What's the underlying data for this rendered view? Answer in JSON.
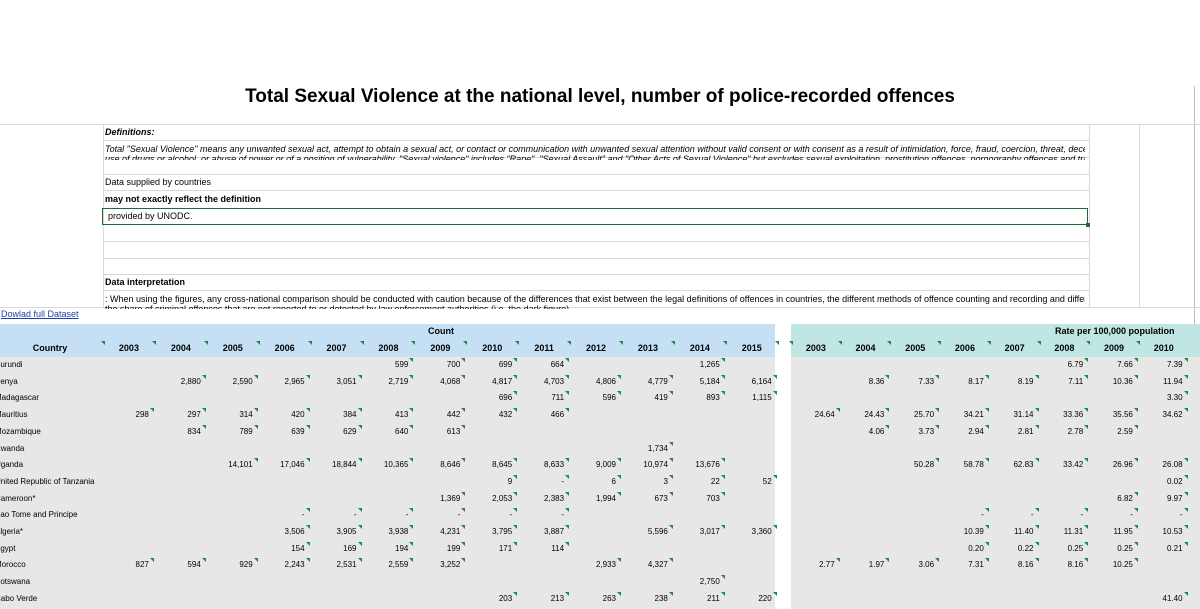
{
  "title": "Total Sexual Violence at the national level, number of police-recorded offences",
  "definitions": {
    "heading": "Definitions:",
    "text_line1": "Total \"Sexual Violence\" means any unwanted sexual act, attempt to obtain a sexual act, or contact or communication with unwanted sexual attention without valid consent or with consent as a result of intimidation, force, fraud, coercion, threat, deception,",
    "text_line2": "use of drugs or alcohol, or abuse of power or of a position of vulnerability. \"Sexual violence\" includes \"Rape\", \"Sexual Assault\" and \"Other Acts of Sexual Violence\" but excludes sexual exploitation, prostitution offences, pornography offences and trafficking",
    "supplied": "Data supplied by countries",
    "may_not": "may not exactly reflect the definition",
    "provided": "provided by UNODC.",
    "interp_heading": "Data interpretation",
    "interp_line1": ": When using the figures, any cross-national comparison should be conducted with caution because of the differences that exist between the legal definitions of offences in countries, the different methods of offence counting and recording and differences in",
    "interp_line2": "the share of criminal offences that are not reported to or detected by law enforcement authorities (i.e. the dark figure)."
  },
  "download_link": "Dowlad full Dataset",
  "count_group": "Count",
  "rate_group": "Rate per 100,000 population",
  "country_header": "Country",
  "count_years": [
    "2003",
    "2004",
    "2005",
    "2006",
    "2007",
    "2008",
    "2009",
    "2010",
    "2011",
    "2012",
    "2013",
    "2014",
    "2015"
  ],
  "rate_years": [
    "2003",
    "2004",
    "2005",
    "2006",
    "2007",
    "2008",
    "2009",
    "2010"
  ],
  "rows": [
    {
      "country": "Burundi",
      "count": [
        "",
        "",
        "",
        "",
        "",
        "599",
        "700",
        "699",
        "664",
        "",
        "",
        "1,265",
        ""
      ],
      "rate": [
        "",
        "",
        "",
        "",
        "",
        "6.79",
        "7.66",
        "7.39"
      ]
    },
    {
      "country": "Kenya",
      "count": [
        "",
        "2,880",
        "2,590",
        "2,965",
        "3,051",
        "2,719",
        "4,068",
        "4,817",
        "4,703",
        "4,806",
        "4,779",
        "5,184",
        "6,164"
      ],
      "rate": [
        "",
        "8.36",
        "7.33",
        "8.17",
        "8.19",
        "7.11",
        "10.36",
        "11.94"
      ]
    },
    {
      "country": "Madagascar",
      "count": [
        "",
        "",
        "",
        "",
        "",
        "",
        "",
        "696",
        "711",
        "596",
        "419",
        "893",
        "1,115"
      ],
      "rate": [
        "",
        "",
        "",
        "",
        "",
        "",
        "",
        "3.30"
      ]
    },
    {
      "country": "Mauritius",
      "count": [
        "298",
        "297",
        "314",
        "420",
        "384",
        "413",
        "442",
        "432",
        "466",
        "",
        "",
        "",
        ""
      ],
      "rate": [
        "24.64",
        "24.43",
        "25.70",
        "34.21",
        "31.14",
        "33.36",
        "35.56",
        "34.62"
      ]
    },
    {
      "country": "Mozambique",
      "count": [
        "",
        "834",
        "789",
        "639",
        "629",
        "640",
        "613",
        "",
        "",
        "",
        "",
        "",
        ""
      ],
      "rate": [
        "",
        "4.06",
        "3.73",
        "2.94",
        "2.81",
        "2.78",
        "2.59",
        ""
      ]
    },
    {
      "country": "Rwanda",
      "count": [
        "",
        "",
        "",
        "",
        "",
        "",
        "",
        "",
        "",
        "",
        "1,734",
        "",
        ""
      ],
      "rate": [
        "",
        "",
        "",
        "",
        "",
        "",
        "",
        ""
      ]
    },
    {
      "country": "Uganda",
      "count": [
        "",
        "",
        "14,101",
        "17,046",
        "18,844",
        "10,365",
        "8,646",
        "8,645",
        "8,633",
        "9,009",
        "10,974",
        "13,676",
        ""
      ],
      "rate": [
        "",
        "",
        "50.28",
        "58.78",
        "62.83",
        "33.42",
        "26.96",
        "26.08"
      ]
    },
    {
      "country": "United Republic of Tanzania",
      "count": [
        "",
        "",
        "",
        "",
        "",
        "",
        "",
        "9",
        "-",
        "6",
        "3",
        "22",
        "52"
      ],
      "rate": [
        "",
        "",
        "",
        "",
        "",
        "",
        "",
        "0.02"
      ]
    },
    {
      "country": "Cameroon*",
      "count": [
        "",
        "",
        "",
        "",
        "",
        "",
        "1,369",
        "2,053",
        "2,383",
        "1,994",
        "673",
        "703",
        ""
      ],
      "rate": [
        "",
        "",
        "",
        "",
        "",
        "",
        "6.82",
        "9.97"
      ]
    },
    {
      "country": "Sao Tome and Principe",
      "count": [
        "",
        "",
        "",
        "-",
        "-",
        "-",
        "-",
        "-",
        "-",
        "",
        "",
        "",
        ""
      ],
      "rate": [
        "",
        "",
        "",
        "-",
        "-",
        "-",
        "-",
        "-"
      ]
    },
    {
      "country": "Algeria*",
      "count": [
        "",
        "",
        "",
        "3,506",
        "3,905",
        "3,938",
        "4,231",
        "3,795",
        "3,887",
        "",
        "5,596",
        "3,017",
        "3,360"
      ],
      "rate": [
        "",
        "",
        "",
        "10.39",
        "11.40",
        "11.31",
        "11.95",
        "10.53"
      ]
    },
    {
      "country": "Egypt",
      "count": [
        "",
        "",
        "",
        "154",
        "169",
        "194",
        "199",
        "171",
        "114",
        "",
        "",
        "",
        ""
      ],
      "rate": [
        "",
        "",
        "",
        "0.20",
        "0.22",
        "0.25",
        "0.25",
        "0.21"
      ]
    },
    {
      "country": "Morocco",
      "count": [
        "827",
        "594",
        "929",
        "2,243",
        "2,531",
        "2,559",
        "3,252",
        "",
        "",
        "2,933",
        "4,327",
        "",
        ""
      ],
      "rate": [
        "2.77",
        "1.97",
        "3.06",
        "7.31",
        "8.16",
        "8.16",
        "10.25",
        ""
      ]
    },
    {
      "country": "Botswana",
      "count": [
        "",
        "",
        "",
        "",
        "",
        "",
        "",
        "",
        "",
        "",
        "",
        "2,750",
        ""
      ],
      "rate": [
        "",
        "",
        "",
        "",
        "",
        "",
        "",
        ""
      ]
    },
    {
      "country": "Cabo Verde",
      "count": [
        "",
        "",
        "",
        "",
        "",
        "",
        "",
        "203",
        "213",
        "263",
        "238",
        "211",
        "220"
      ],
      "rate": [
        "",
        "",
        "",
        "",
        "",
        "",
        "",
        "41.40"
      ]
    }
  ]
}
